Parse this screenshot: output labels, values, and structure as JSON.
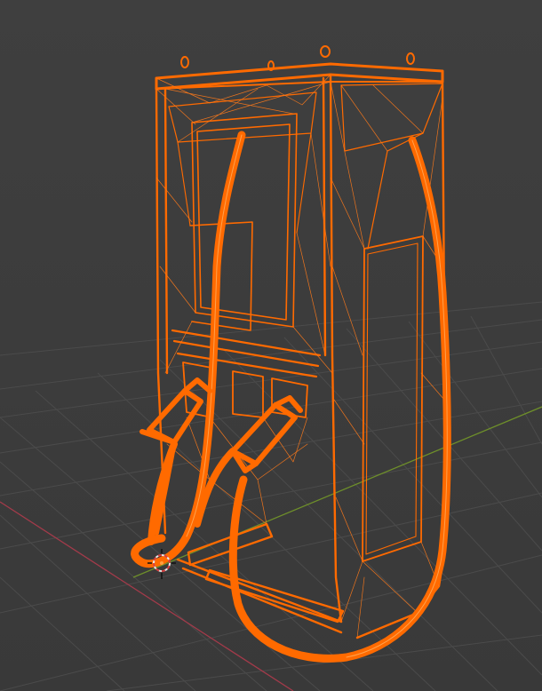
{
  "viewport": {
    "background": "#3d3d3d",
    "grid_color": "#4a4a4a",
    "x_axis_color": "#a33a4a",
    "y_axis_color": "#6e8f2a",
    "wire_color": "#ff6a00",
    "wire_color_light": "#ff8a2a",
    "mode": "wireframe",
    "selected_object": "charging-station-model",
    "origin_icon": "3d-cursor-icon"
  }
}
